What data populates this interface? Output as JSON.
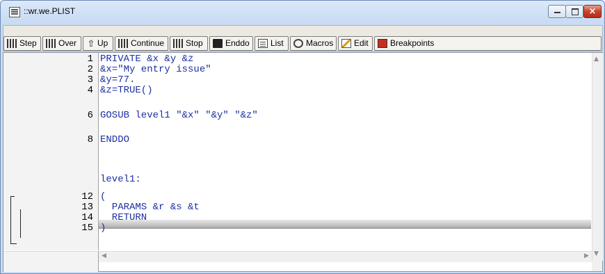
{
  "window": {
    "title": "::wr.we.PLIST",
    "close_glyph": "×"
  },
  "toolbar": {
    "buttons": [
      {
        "label": "Step",
        "icon": "step-icon"
      },
      {
        "label": "Over",
        "icon": "over-icon"
      },
      {
        "label": "Up",
        "icon": "up-icon"
      },
      {
        "label": "Continue",
        "icon": "continue-icon"
      },
      {
        "label": "Stop",
        "icon": "stop-icon"
      },
      {
        "label": "Enddo",
        "icon": "enddo-icon"
      },
      {
        "label": "List",
        "icon": "list-icon"
      },
      {
        "label": "Macros",
        "icon": "macros-icon"
      },
      {
        "label": "Edit",
        "icon": "edit-icon"
      },
      {
        "label": "Breakpoints",
        "icon": "breakpoints-icon"
      }
    ]
  },
  "editor": {
    "lines": [
      {
        "num": "1",
        "text": "PRIVATE &x &y &z"
      },
      {
        "num": "2",
        "text": "&x=\"My entry issue\""
      },
      {
        "num": "3",
        "text": "&y=77."
      },
      {
        "num": "4",
        "text": "&z=TRUE()"
      },
      {
        "num": "6",
        "text": "GOSUB level1 \"&x\" \"&y\" \"&z\""
      },
      {
        "num": "8",
        "text": "ENDDO"
      },
      {
        "num": "",
        "text": "level1:"
      },
      {
        "num": "12",
        "text": "("
      },
      {
        "num": "13",
        "text": "  PARAMS &r &s &t"
      },
      {
        "num": "14",
        "text": "  RETURN"
      },
      {
        "num": "15",
        "text": ")"
      }
    ],
    "current_line": "14",
    "colors": {
      "code": "#1d2fa3",
      "line_number": "#000000",
      "highlight": "#bdbdbd"
    }
  }
}
